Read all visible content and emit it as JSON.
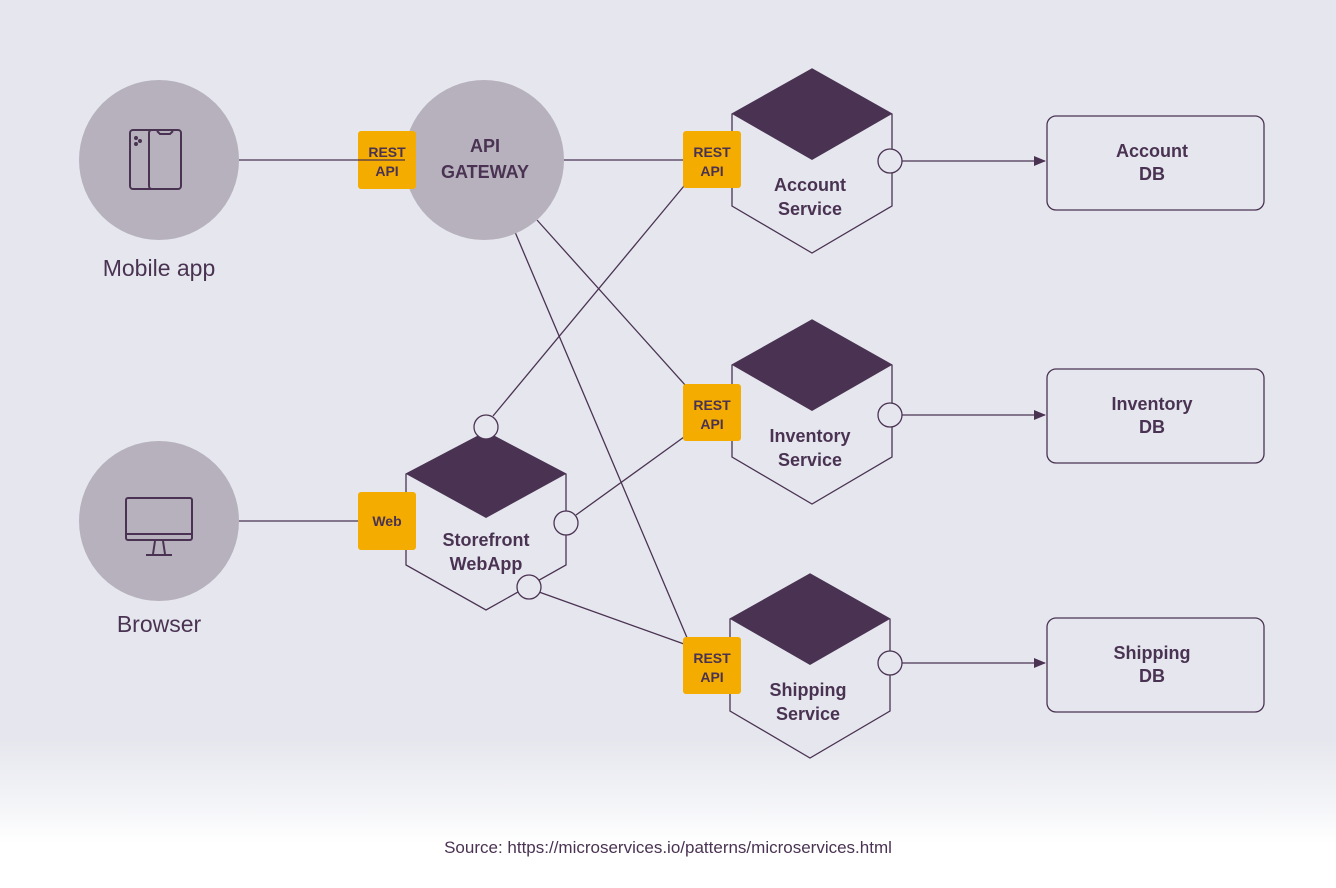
{
  "colors": {
    "background": "#e6e7ee",
    "node_grey": "#b7b1be",
    "accent": "#f5ac00",
    "ink": "#4a3352"
  },
  "clients": [
    {
      "label": "Mobile app",
      "icon": "mobile-phones-icon"
    },
    {
      "label": "Browser",
      "icon": "desktop-monitor-icon"
    }
  ],
  "gateway": {
    "line1": "API",
    "line2": "GATEWAY",
    "api_tag": [
      "REST",
      "API"
    ]
  },
  "storefront": {
    "line1": "Storefront",
    "line2": "WebApp",
    "tag": "Web"
  },
  "services": [
    {
      "line1": "Account",
      "line2": "Service",
      "api_tag": [
        "REST",
        "API"
      ],
      "db": [
        "Account",
        "DB"
      ]
    },
    {
      "line1": "Inventory",
      "line2": "Service",
      "api_tag": [
        "REST",
        "API"
      ],
      "db": [
        "Inventory",
        "DB"
      ]
    },
    {
      "line1": "Shipping",
      "line2": "Service",
      "api_tag": [
        "REST",
        "API"
      ],
      "db": [
        "Shipping",
        "DB"
      ]
    }
  ],
  "source": "Source: https://microservices.io/patterns/microservices.html"
}
